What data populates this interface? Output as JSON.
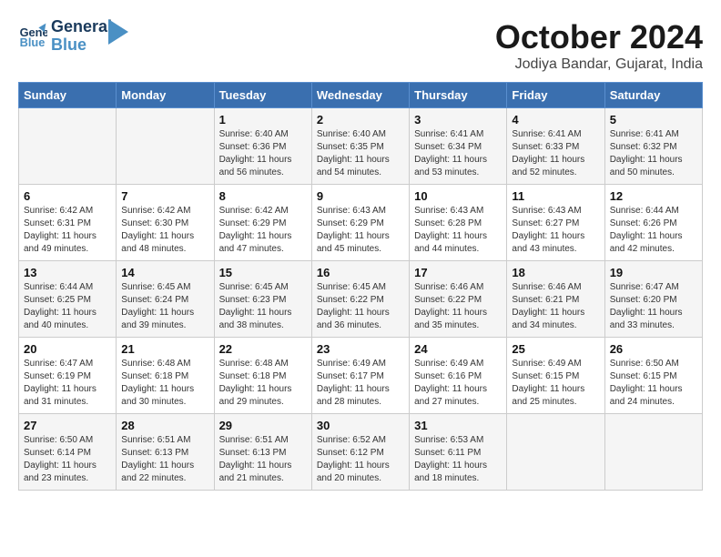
{
  "logo": {
    "text_general": "General",
    "text_blue": "Blue"
  },
  "title": "October 2024",
  "location": "Jodiya Bandar, Gujarat, India",
  "days_of_week": [
    "Sunday",
    "Monday",
    "Tuesday",
    "Wednesday",
    "Thursday",
    "Friday",
    "Saturday"
  ],
  "weeks": [
    [
      {
        "day": "",
        "sunrise": "",
        "sunset": "",
        "daylight": ""
      },
      {
        "day": "",
        "sunrise": "",
        "sunset": "",
        "daylight": ""
      },
      {
        "day": "1",
        "sunrise": "Sunrise: 6:40 AM",
        "sunset": "Sunset: 6:36 PM",
        "daylight": "Daylight: 11 hours and 56 minutes."
      },
      {
        "day": "2",
        "sunrise": "Sunrise: 6:40 AM",
        "sunset": "Sunset: 6:35 PM",
        "daylight": "Daylight: 11 hours and 54 minutes."
      },
      {
        "day": "3",
        "sunrise": "Sunrise: 6:41 AM",
        "sunset": "Sunset: 6:34 PM",
        "daylight": "Daylight: 11 hours and 53 minutes."
      },
      {
        "day": "4",
        "sunrise": "Sunrise: 6:41 AM",
        "sunset": "Sunset: 6:33 PM",
        "daylight": "Daylight: 11 hours and 52 minutes."
      },
      {
        "day": "5",
        "sunrise": "Sunrise: 6:41 AM",
        "sunset": "Sunset: 6:32 PM",
        "daylight": "Daylight: 11 hours and 50 minutes."
      }
    ],
    [
      {
        "day": "6",
        "sunrise": "Sunrise: 6:42 AM",
        "sunset": "Sunset: 6:31 PM",
        "daylight": "Daylight: 11 hours and 49 minutes."
      },
      {
        "day": "7",
        "sunrise": "Sunrise: 6:42 AM",
        "sunset": "Sunset: 6:30 PM",
        "daylight": "Daylight: 11 hours and 48 minutes."
      },
      {
        "day": "8",
        "sunrise": "Sunrise: 6:42 AM",
        "sunset": "Sunset: 6:29 PM",
        "daylight": "Daylight: 11 hours and 47 minutes."
      },
      {
        "day": "9",
        "sunrise": "Sunrise: 6:43 AM",
        "sunset": "Sunset: 6:29 PM",
        "daylight": "Daylight: 11 hours and 45 minutes."
      },
      {
        "day": "10",
        "sunrise": "Sunrise: 6:43 AM",
        "sunset": "Sunset: 6:28 PM",
        "daylight": "Daylight: 11 hours and 44 minutes."
      },
      {
        "day": "11",
        "sunrise": "Sunrise: 6:43 AM",
        "sunset": "Sunset: 6:27 PM",
        "daylight": "Daylight: 11 hours and 43 minutes."
      },
      {
        "day": "12",
        "sunrise": "Sunrise: 6:44 AM",
        "sunset": "Sunset: 6:26 PM",
        "daylight": "Daylight: 11 hours and 42 minutes."
      }
    ],
    [
      {
        "day": "13",
        "sunrise": "Sunrise: 6:44 AM",
        "sunset": "Sunset: 6:25 PM",
        "daylight": "Daylight: 11 hours and 40 minutes."
      },
      {
        "day": "14",
        "sunrise": "Sunrise: 6:45 AM",
        "sunset": "Sunset: 6:24 PM",
        "daylight": "Daylight: 11 hours and 39 minutes."
      },
      {
        "day": "15",
        "sunrise": "Sunrise: 6:45 AM",
        "sunset": "Sunset: 6:23 PM",
        "daylight": "Daylight: 11 hours and 38 minutes."
      },
      {
        "day": "16",
        "sunrise": "Sunrise: 6:45 AM",
        "sunset": "Sunset: 6:22 PM",
        "daylight": "Daylight: 11 hours and 36 minutes."
      },
      {
        "day": "17",
        "sunrise": "Sunrise: 6:46 AM",
        "sunset": "Sunset: 6:22 PM",
        "daylight": "Daylight: 11 hours and 35 minutes."
      },
      {
        "day": "18",
        "sunrise": "Sunrise: 6:46 AM",
        "sunset": "Sunset: 6:21 PM",
        "daylight": "Daylight: 11 hours and 34 minutes."
      },
      {
        "day": "19",
        "sunrise": "Sunrise: 6:47 AM",
        "sunset": "Sunset: 6:20 PM",
        "daylight": "Daylight: 11 hours and 33 minutes."
      }
    ],
    [
      {
        "day": "20",
        "sunrise": "Sunrise: 6:47 AM",
        "sunset": "Sunset: 6:19 PM",
        "daylight": "Daylight: 11 hours and 31 minutes."
      },
      {
        "day": "21",
        "sunrise": "Sunrise: 6:48 AM",
        "sunset": "Sunset: 6:18 PM",
        "daylight": "Daylight: 11 hours and 30 minutes."
      },
      {
        "day": "22",
        "sunrise": "Sunrise: 6:48 AM",
        "sunset": "Sunset: 6:18 PM",
        "daylight": "Daylight: 11 hours and 29 minutes."
      },
      {
        "day": "23",
        "sunrise": "Sunrise: 6:49 AM",
        "sunset": "Sunset: 6:17 PM",
        "daylight": "Daylight: 11 hours and 28 minutes."
      },
      {
        "day": "24",
        "sunrise": "Sunrise: 6:49 AM",
        "sunset": "Sunset: 6:16 PM",
        "daylight": "Daylight: 11 hours and 27 minutes."
      },
      {
        "day": "25",
        "sunrise": "Sunrise: 6:49 AM",
        "sunset": "Sunset: 6:15 PM",
        "daylight": "Daylight: 11 hours and 25 minutes."
      },
      {
        "day": "26",
        "sunrise": "Sunrise: 6:50 AM",
        "sunset": "Sunset: 6:15 PM",
        "daylight": "Daylight: 11 hours and 24 minutes."
      }
    ],
    [
      {
        "day": "27",
        "sunrise": "Sunrise: 6:50 AM",
        "sunset": "Sunset: 6:14 PM",
        "daylight": "Daylight: 11 hours and 23 minutes."
      },
      {
        "day": "28",
        "sunrise": "Sunrise: 6:51 AM",
        "sunset": "Sunset: 6:13 PM",
        "daylight": "Daylight: 11 hours and 22 minutes."
      },
      {
        "day": "29",
        "sunrise": "Sunrise: 6:51 AM",
        "sunset": "Sunset: 6:13 PM",
        "daylight": "Daylight: 11 hours and 21 minutes."
      },
      {
        "day": "30",
        "sunrise": "Sunrise: 6:52 AM",
        "sunset": "Sunset: 6:12 PM",
        "daylight": "Daylight: 11 hours and 20 minutes."
      },
      {
        "day": "31",
        "sunrise": "Sunrise: 6:53 AM",
        "sunset": "Sunset: 6:11 PM",
        "daylight": "Daylight: 11 hours and 18 minutes."
      },
      {
        "day": "",
        "sunrise": "",
        "sunset": "",
        "daylight": ""
      },
      {
        "day": "",
        "sunrise": "",
        "sunset": "",
        "daylight": ""
      }
    ]
  ]
}
